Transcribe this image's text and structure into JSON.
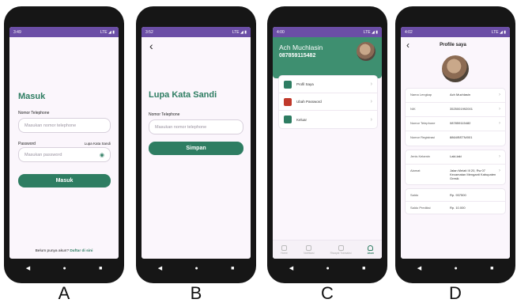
{
  "status": {
    "a_time": "3:49",
    "b_time": "3:52",
    "c_time": "4:00",
    "d_time": "4:02",
    "right": "LTE ◢ ▮"
  },
  "nav": {
    "back": "◀",
    "home": "●",
    "recent": "■"
  },
  "captions": [
    "A",
    "B",
    "C",
    "D"
  ],
  "screen_a": {
    "title": "Masuk",
    "phone_label": "Nomor Telephone",
    "phone_placeholder": "Masukan nomor telephone",
    "password_label": "Password",
    "forgot_link": "Lupa Kata Sandi",
    "password_placeholder": "Masukan password",
    "login_button": "Masuk",
    "signup_prefix": "Belum punya akun?",
    "signup_link": "Daftar di sini"
  },
  "screen_b": {
    "back": "‹",
    "title": "Lupa Kata Sandi",
    "phone_label": "Nomor Telephone",
    "phone_placeholder": "Masukan nomor telephone",
    "save_button": "Simpan"
  },
  "screen_c": {
    "name": "Ach Muchlasin",
    "phone": "087859115482",
    "menu": [
      {
        "label": "Profil Saya",
        "icon": "profile-icon",
        "color": "#2e7d62"
      },
      {
        "label": "Ubah Password",
        "icon": "lock-icon",
        "color": "#c0392b"
      },
      {
        "label": "Keluar",
        "icon": "logout-icon",
        "color": "#2e7d62"
      }
    ],
    "tabs": [
      "Home",
      "Notifikasi",
      "Riwayat Transaksi",
      "Akun"
    ]
  },
  "screen_d": {
    "back": "‹",
    "title": "Profile saya",
    "card1": [
      {
        "k": "Nama Lengkap",
        "v": "Ach Muchlasin"
      },
      {
        "k": "NIK",
        "v": "3525001992001"
      },
      {
        "k": "Nomor Telephone",
        "v": "087859115482"
      },
      {
        "k": "Nomor Registrasi",
        "v": "8864/BSTN/001"
      }
    ],
    "card2": [
      {
        "k": "Jenis Kelamin",
        "v": "Laki-laki"
      },
      {
        "k": "Alamat",
        "v": "Jalan Melati III 20, Rw 07 Kecamatan Menganti Kabupaten Gresik"
      }
    ],
    "card3": [
      {
        "k": "Saldo",
        "v": "Rp. 937500"
      },
      {
        "k": "Saldo Prediksi",
        "v": "Rp. 10.000"
      }
    ]
  },
  "colors": {
    "primary": "#2e7d62",
    "statusbar": "#6b4ea6",
    "background": "#fbf6fc"
  }
}
